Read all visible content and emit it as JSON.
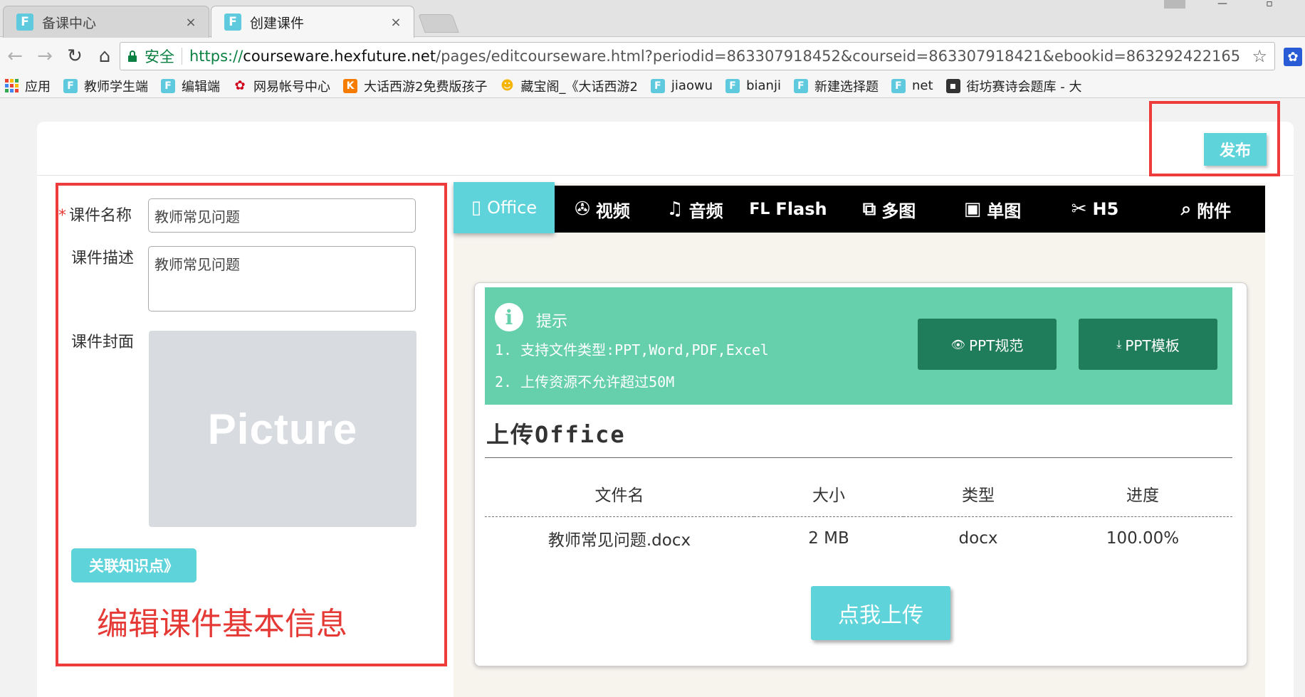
{
  "browser": {
    "tabs": [
      {
        "title": "备课中心",
        "favicon": "F"
      },
      {
        "title": "创建课件",
        "favicon": "F"
      }
    ],
    "tab_close_glyph": "×",
    "address": {
      "secure_label": "安全",
      "scheme": "https://",
      "host": "courseware.hexfuture.net",
      "path": "/pages/editcourseware.html?periodid=863307918452&courseid=863307918421&ebookid=863292422165"
    },
    "bookmarks": [
      {
        "label": "应用",
        "icon": "apps-icon"
      },
      {
        "label": "教师学生端",
        "icon": "F"
      },
      {
        "label": "编辑端",
        "icon": "F"
      },
      {
        "label": "网易帐号中心",
        "icon": "netease-icon"
      },
      {
        "label": "大话西游2免费版孩子",
        "icon": "K"
      },
      {
        "label": "藏宝阁_《大话西游2",
        "icon": "chick-icon"
      },
      {
        "label": "jiaowu",
        "icon": "F"
      },
      {
        "label": "bianji",
        "icon": "F"
      },
      {
        "label": "新建选择题",
        "icon": "F"
      },
      {
        "label": "net",
        "icon": "F"
      },
      {
        "label": "街坊赛诗会题库 - 大",
        "icon": "dark-icon"
      }
    ]
  },
  "header": {
    "publish_label": "发布"
  },
  "form": {
    "name_label": "课件名称",
    "required_mark": "*",
    "name_value": "教师常见问题",
    "desc_label": "课件描述",
    "desc_value": "教师常见问题",
    "cover_label": "课件封面",
    "cover_placeholder": "Picture",
    "link_knowledge_label": "关联知识点》",
    "annotation": "编辑课件基本信息"
  },
  "type_tabs": [
    {
      "icon": "office-icon",
      "glyph": "▯",
      "label": "Office"
    },
    {
      "icon": "video-icon",
      "glyph": "✇",
      "label": "视频"
    },
    {
      "icon": "music-icon",
      "glyph": "♫",
      "label": "音频"
    },
    {
      "icon": "flash-icon",
      "glyph": "FL",
      "label": "Flash"
    },
    {
      "icon": "images-icon",
      "glyph": "⧉",
      "label": "多图"
    },
    {
      "icon": "image-icon",
      "glyph": "▣",
      "label": "单图"
    },
    {
      "icon": "tools-icon",
      "glyph": "✂",
      "label": "H5"
    },
    {
      "icon": "paperclip-icon",
      "glyph": "⌕",
      "label": "附件"
    }
  ],
  "upload": {
    "hint_title": "提示",
    "hint_line1": "1. 支持文件类型:PPT,Word,PDF,Excel",
    "hint_line2": "2. 上传资源不允许超过50M",
    "ppt_spec_label": "PPT规范",
    "ppt_template_label": "PPT模板",
    "title": "上传Office",
    "columns": [
      "文件名",
      "大小",
      "类型",
      "进度"
    ],
    "rows": [
      [
        "教师常见问题.docx",
        "2 MB",
        "docx",
        "100.00%"
      ]
    ],
    "upload_button_label": "点我上传"
  },
  "colors": {
    "accent": "#5fd3da",
    "hint_green": "#66cfac",
    "dark_green": "#1f7d5b",
    "annotation_red": "#ee3b3b"
  }
}
